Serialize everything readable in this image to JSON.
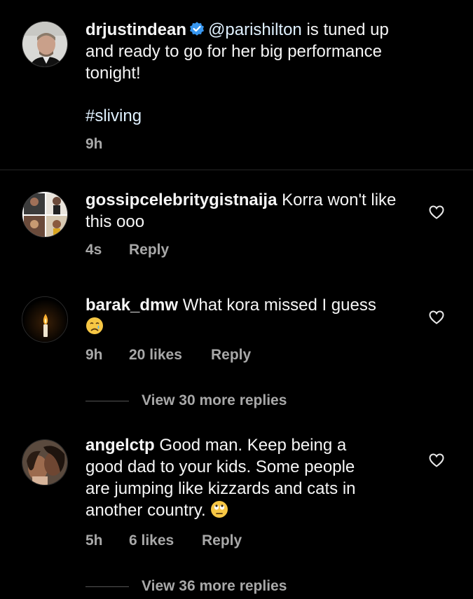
{
  "post": {
    "username": "drjustindean",
    "mention": "@parishilton",
    "text_line1_rest": " is tuned up",
    "text_line2": "and ready to go for her big performance",
    "text_line3": "tonight!",
    "hashtag": "#sliving",
    "time": "9h"
  },
  "comments": [
    {
      "username": "gossipcelebritygistnaija",
      "text_line1": " Korra won't like",
      "text_line2": "this ooo",
      "time": "4s",
      "likes": "",
      "reply": "Reply"
    },
    {
      "username": "barak_dmw",
      "text_line1": " What kora missed I guess",
      "emoji": "crying-face",
      "time": "9h",
      "likes": "20 likes",
      "reply": "Reply",
      "view_more": "View 30 more replies"
    },
    {
      "username": "angelctp",
      "text_line1": " Good man. Keep being a",
      "text_line2": "good dad to your kids. Some people",
      "text_line3": "are jumping like kizzards and cats in",
      "text_line4": "another country. ",
      "emoji": "face-with-rolling-eyes",
      "time": "5h",
      "likes": "6 likes",
      "reply": "Reply",
      "view_more": "View 36 more replies"
    }
  ],
  "colors": {
    "background": "#000000",
    "text": "#f5f5f5",
    "secondary": "#a8a8a8",
    "verified": "#3897f0",
    "divider": "#262626"
  }
}
